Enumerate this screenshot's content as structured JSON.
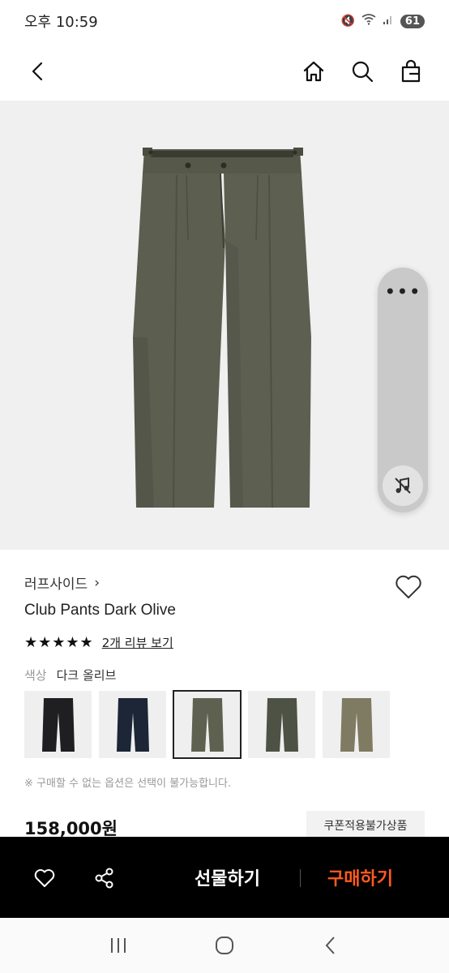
{
  "status_bar": {
    "time": "오후 10:59",
    "battery": "61"
  },
  "nav": {
    "back_icon": "chevron-left-icon",
    "home_icon": "home-icon",
    "search_icon": "search-icon",
    "cart_icon": "shopping-bag-icon"
  },
  "floating_panel": {
    "more_label": "•••",
    "mute_icon": "music-off-icon"
  },
  "product": {
    "brand": "러프사이드",
    "brand_chevron": "›",
    "name": "Club Pants Dark Olive",
    "stars": "★★★★★",
    "review_link": "2개 리뷰 보기",
    "color_label": "색상",
    "color_value": "다크 올리브",
    "notice": "※ 구매할 수 없는 옵션은 선택이 불가능합니다.",
    "price": "158,000원",
    "coupon_badge": "쿠폰적용불가상품"
  },
  "swatches": [
    {
      "name": "black",
      "color": "#1f1f22"
    },
    {
      "name": "navy",
      "color": "#1c2636"
    },
    {
      "name": "dark-olive",
      "color": "#5f6150",
      "selected": true
    },
    {
      "name": "olive",
      "color": "#4d5244"
    },
    {
      "name": "khaki",
      "color": "#7f7a62"
    }
  ],
  "action_bar": {
    "gift_label": "선물하기",
    "buy_label": "구매하기",
    "buy_color": "#ff5a1f"
  },
  "colors": {
    "hero_bg": "#f0f0f0",
    "pants_color": "#5c5e50"
  }
}
